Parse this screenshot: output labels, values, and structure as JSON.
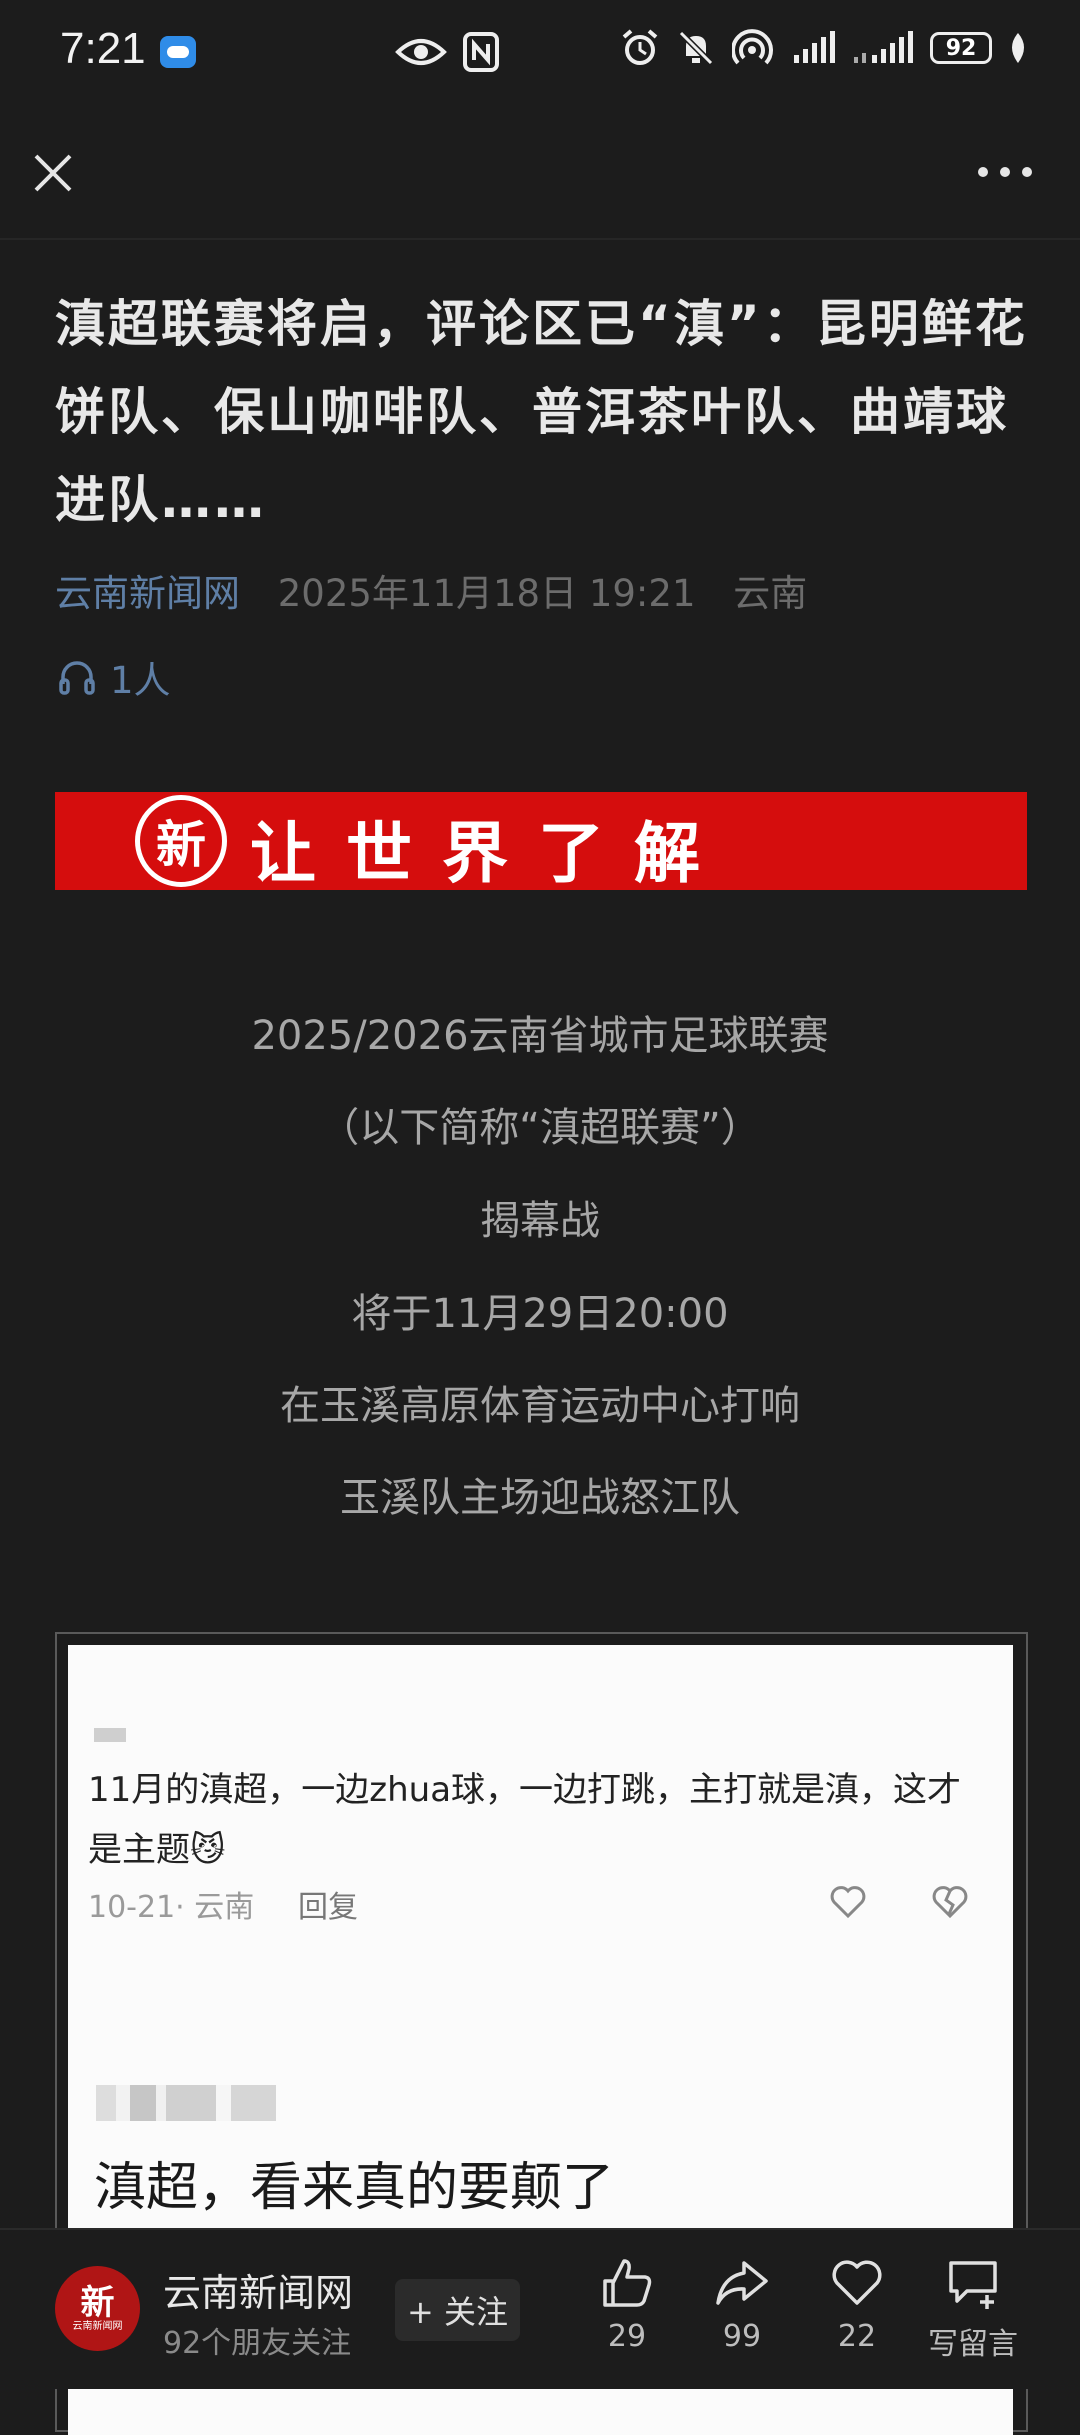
{
  "status_bar": {
    "time": "7:21",
    "battery": "92"
  },
  "article": {
    "title": "滇超联赛将启，评论区已“滇”：昆明鲜花饼队、保山咖啡队、普洱茶叶队、曲靖球进队……",
    "source": "云南新闻网",
    "datetime": "2025年11月18日 19:21",
    "region": "云南",
    "listeners": "1人",
    "banner_logo": "新",
    "banner_text": "让世界了解",
    "paragraphs": [
      "2025/2026云南省城市足球联赛",
      "（以下简称“滇超联赛”）",
      "揭幕战",
      "将于11月29日20:00",
      "在玉溪高原体育运动中心打响",
      "玉溪队主场迎战怒江队"
    ]
  },
  "comment_screenshot": {
    "comment1_text": "11月的滇超，一边zhua球，一边打跳，主打就是滇，这才是主题😼",
    "comment1_meta": "10-21· 云南",
    "comment1_reply": "回复",
    "comment2_text": "滇超，看来真的要颠了"
  },
  "bottom_bar": {
    "avatar_text": "新",
    "avatar_sub": "云南新闻网",
    "account_name": "云南新闻网",
    "followers": "92个朋友关注",
    "follow_label": "+ 关注",
    "likes": "29",
    "shares": "99",
    "favorites": "22",
    "comment_label": "写留言"
  },
  "colors": {
    "banner_red": "#d50d0d",
    "link_blue": "#5f7fa6",
    "background": "#1c1c1c"
  }
}
